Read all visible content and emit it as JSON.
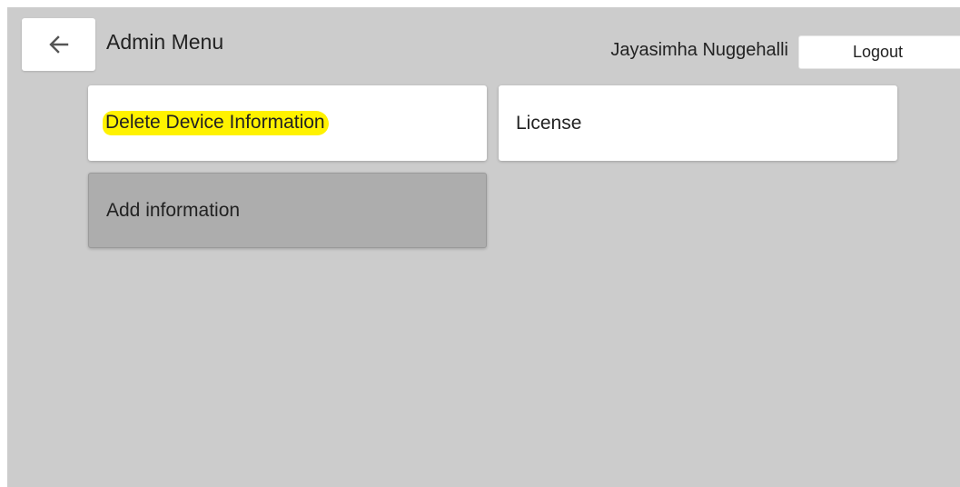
{
  "header": {
    "back_icon": "arrow-left-icon",
    "title": "Admin Menu",
    "user_name": "Jayasimha Nuggehalli",
    "logout_label": "Logout"
  },
  "menu": {
    "items": [
      {
        "label": "Delete Device Information",
        "highlighted": true
      },
      {
        "label": "License",
        "highlighted": false
      },
      {
        "label": "Add information",
        "selected": true
      }
    ]
  },
  "colors": {
    "background": "#cccccc",
    "tile": "#ffffff",
    "tile_selected": "#adadad",
    "highlight": "#fff200"
  }
}
